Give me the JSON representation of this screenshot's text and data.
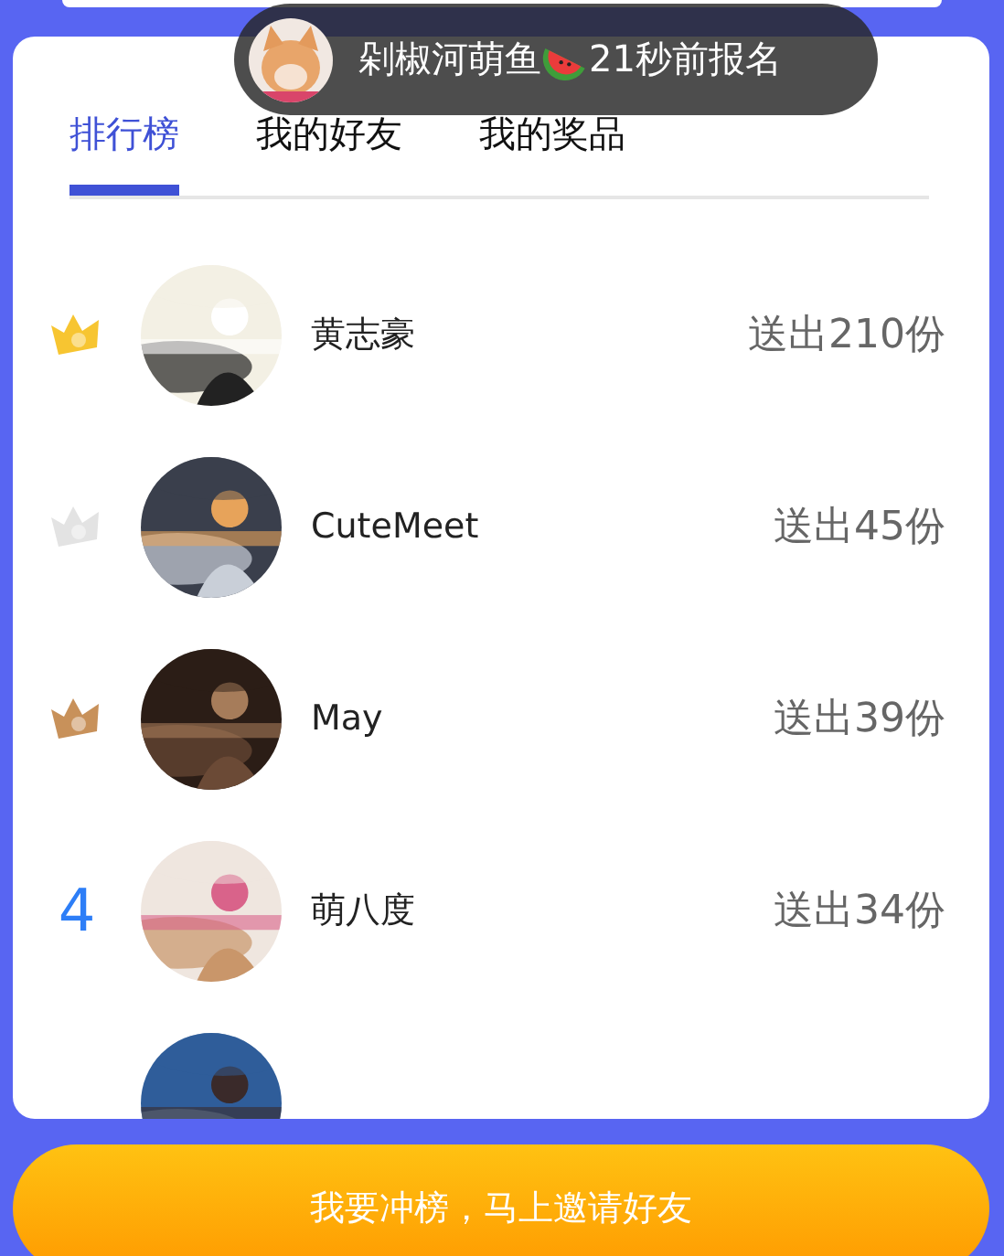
{
  "toast": {
    "name": "剁椒河萌鱼",
    "message": "21秒前报名"
  },
  "tabs": [
    {
      "label": "排行榜",
      "selected": true
    },
    {
      "label": "我的好友",
      "selected": false
    },
    {
      "label": "我的奖品",
      "selected": false
    }
  ],
  "rows": [
    {
      "kind": "crown",
      "color": "#f7c531",
      "name": "黄志豪",
      "gift": "送出210份"
    },
    {
      "kind": "crown",
      "color": "#e3e3e3",
      "name": "CuteMeet",
      "gift": "送出45份"
    },
    {
      "kind": "crown",
      "color": "#c8915a",
      "name": "May",
      "gift": "送出39份"
    },
    {
      "kind": "number",
      "rank": "4",
      "name": "萌八度",
      "gift": "送出34份"
    },
    {
      "kind": "number"
    }
  ],
  "button": "我要冲榜，马上邀请好友"
}
